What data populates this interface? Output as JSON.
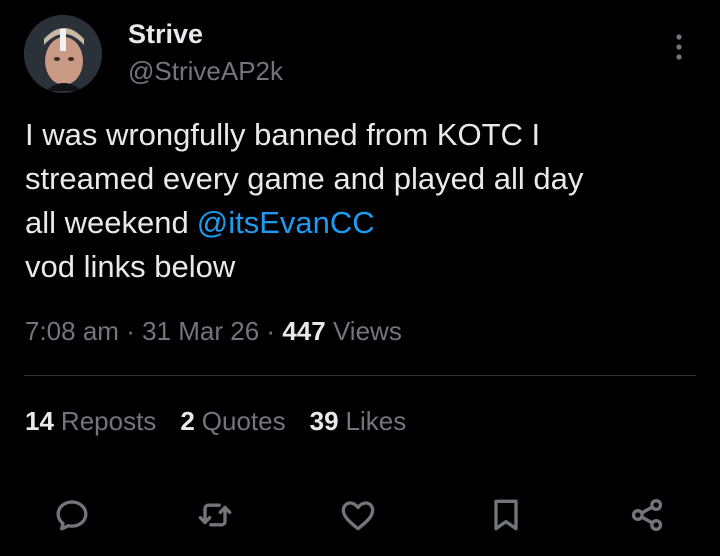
{
  "tweet": {
    "author": {
      "display_name": "Strive",
      "handle": "@StriveAP2k",
      "avatar_icon": "user-avatar"
    },
    "more_icon": "more-vertical-icon",
    "text_lines": [
      "I was wrongfully banned from KOTC I",
      "streamed every game and played all day",
      "all weekend",
      "vod links below"
    ],
    "mention": "@itsEvanCC",
    "time": "7:08 am",
    "date": "31 Mar 26",
    "separator": "·",
    "views_count": "447",
    "views_label": "Views",
    "stats": {
      "reposts_count": "14",
      "reposts_label": "Reposts",
      "quotes_count": "2",
      "quotes_label": "Quotes",
      "likes_count": "39",
      "likes_label": "Likes"
    }
  },
  "actions": {
    "reply_icon": "reply-icon",
    "repost_icon": "repost-icon",
    "like_icon": "heart-icon",
    "bookmark_icon": "bookmark-icon",
    "share_icon": "share-icon"
  },
  "colors": {
    "background": "#000000",
    "primary_text": "#e7e9ea",
    "secondary_text": "#71767b",
    "link": "#1d9bf0",
    "divider": "#2f3336"
  }
}
